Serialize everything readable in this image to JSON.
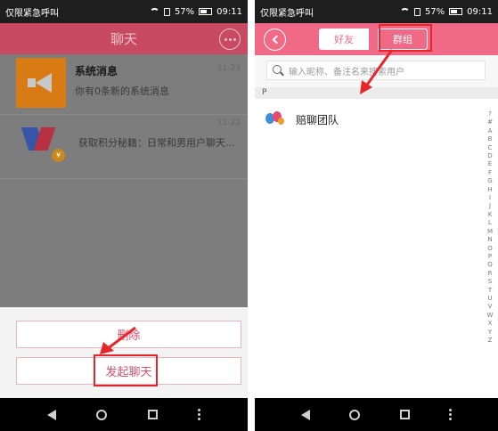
{
  "status_bar": {
    "carrier": "仅限紧急呼叫",
    "battery": "57%",
    "time": "09:11"
  },
  "left_screen": {
    "header_title": "聊天",
    "chats": [
      {
        "name": "系统消息",
        "time": "11-23",
        "preview": "你有0条新的系统消息",
        "avatar_icon": "megaphone-icon"
      },
      {
        "name": "",
        "time": "11-22",
        "preview": "获取积分秘籍：日常和男用户聊天...",
        "avatar_icon": "team-logo-icon"
      }
    ],
    "action_sheet": {
      "delete_label": "删除",
      "start_chat_label": "发起聊天"
    }
  },
  "right_screen": {
    "tabs": {
      "friends": "好友",
      "groups": "群组"
    },
    "search_placeholder": "输入昵称、备注名来搜索用户",
    "section_letter": "P",
    "contacts": [
      {
        "name": "赔聊团队"
      }
    ],
    "alphabet": [
      "?",
      "#",
      "A",
      "B",
      "C",
      "D",
      "E",
      "F",
      "G",
      "H",
      "I",
      "J",
      "K",
      "L",
      "M",
      "N",
      "O",
      "P",
      "Q",
      "R",
      "S",
      "T",
      "U",
      "V",
      "W",
      "X",
      "Y",
      "Z"
    ]
  },
  "colors": {
    "accent_pink": "#f06a87",
    "annotation_red": "#e8262a",
    "dim_header": "#c84a62"
  }
}
